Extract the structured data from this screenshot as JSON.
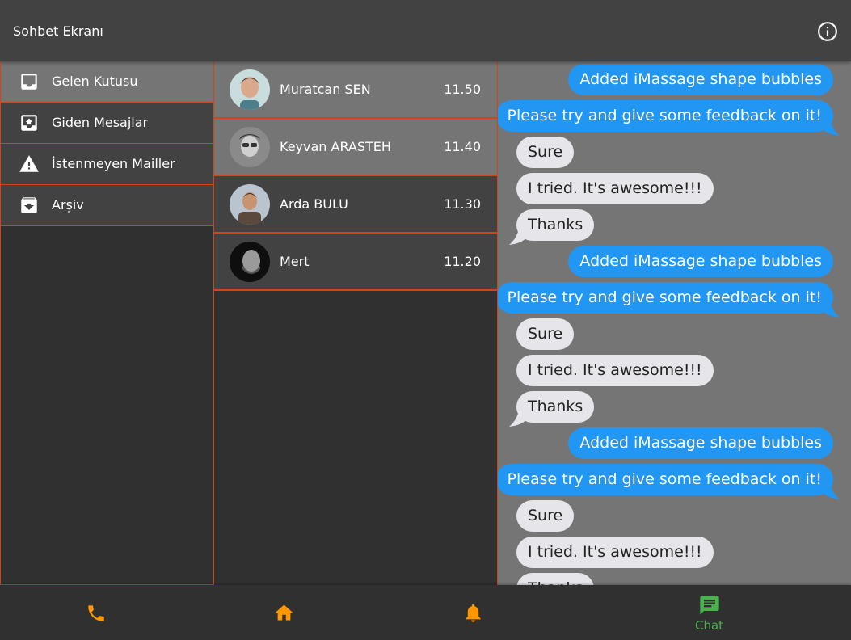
{
  "appbar": {
    "title": "Sohbet Ekranı",
    "info_icon": "info-icon"
  },
  "colors": {
    "accent": "#ff9800",
    "divider": "#d84315",
    "sent_bubble": "#2196f3",
    "recv_bubble": "#e5e5ea",
    "active_tab": "#4caf50"
  },
  "sidebar": {
    "items": [
      {
        "label": "Gelen Kutusu",
        "icon": "inbox-icon"
      },
      {
        "label": "Giden Mesajlar",
        "icon": "outbox-icon"
      },
      {
        "label": "İstenmeyen Mailler",
        "icon": "warning-icon"
      },
      {
        "label": "Arşiv",
        "icon": "archive-icon"
      }
    ]
  },
  "contacts": [
    {
      "name": "Muratcan SEN",
      "time": "11.50"
    },
    {
      "name": "Keyvan ARASTEH",
      "time": "11.40"
    },
    {
      "name": "Arda BULU",
      "time": "11.30"
    },
    {
      "name": "Mert",
      "time": "11.20"
    }
  ],
  "messages": [
    {
      "text": "Added iMassage shape bubbles",
      "sender": "me"
    },
    {
      "text": "Please try and give some feedback on it!",
      "sender": "me"
    },
    {
      "text": "Sure",
      "sender": "other"
    },
    {
      "text": "I tried. It's awesome!!!",
      "sender": "other"
    },
    {
      "text": "Thanks",
      "sender": "other"
    },
    {
      "text": "Added iMassage shape bubbles",
      "sender": "me"
    },
    {
      "text": "Please try and give some feedback on it!",
      "sender": "me"
    },
    {
      "text": "Sure",
      "sender": "other"
    },
    {
      "text": "I tried. It's awesome!!!",
      "sender": "other"
    },
    {
      "text": "Thanks",
      "sender": "other"
    },
    {
      "text": "Added iMassage shape bubbles",
      "sender": "me"
    },
    {
      "text": "Please try and give some feedback on it!",
      "sender": "me"
    },
    {
      "text": "Sure",
      "sender": "other"
    },
    {
      "text": "I tried. It's awesome!!!",
      "sender": "other"
    },
    {
      "text": "Thanks",
      "sender": "other"
    }
  ],
  "bottom_nav": {
    "tabs": [
      {
        "icon": "phone-icon"
      },
      {
        "icon": "home-icon"
      },
      {
        "icon": "bell-icon"
      },
      {
        "icon": "chat-icon",
        "label": "Chat"
      }
    ]
  }
}
